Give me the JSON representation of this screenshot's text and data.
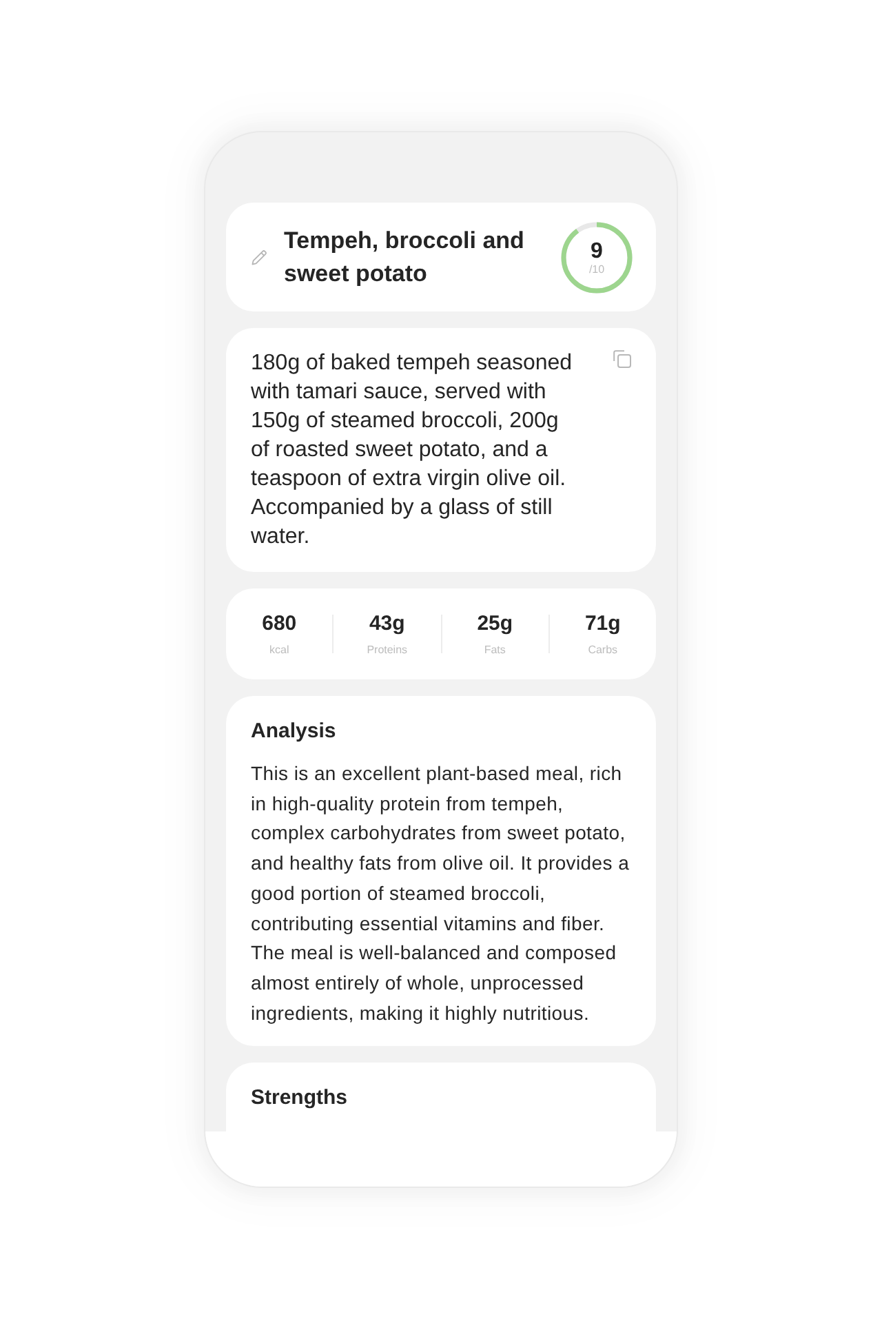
{
  "meal": {
    "title": "Tempeh, broccoli and sweet potato",
    "score": {
      "value": "9",
      "max": "/10",
      "level": 0.9
    }
  },
  "description": "180g of baked tempeh seasoned with tamari sauce, served with 150g of steamed broccoli, 200g of roasted sweet potato, and a teaspoon of extra virgin olive oil. Accompanied by a glass of still water.",
  "nutrients": [
    {
      "value": "680",
      "unit": "kcal"
    },
    {
      "value": "43g",
      "unit": "Proteins"
    },
    {
      "value": "25g",
      "unit": "Fats"
    },
    {
      "value": "71g",
      "unit": "Carbs"
    }
  ],
  "analysis": {
    "heading": "Analysis",
    "text": "This is an excellent plant-based meal, rich in high-quality protein from tempeh, complex carbohydrates from sweet potato, and healthy fats from olive oil. It provides a good portion of steamed broccoli, contributing essential vitamins and fiber. The meal is well-balanced and composed almost entirely of whole, unprocessed ingredients, making it highly nutritious."
  },
  "strengths": {
    "heading": "Strengths"
  }
}
